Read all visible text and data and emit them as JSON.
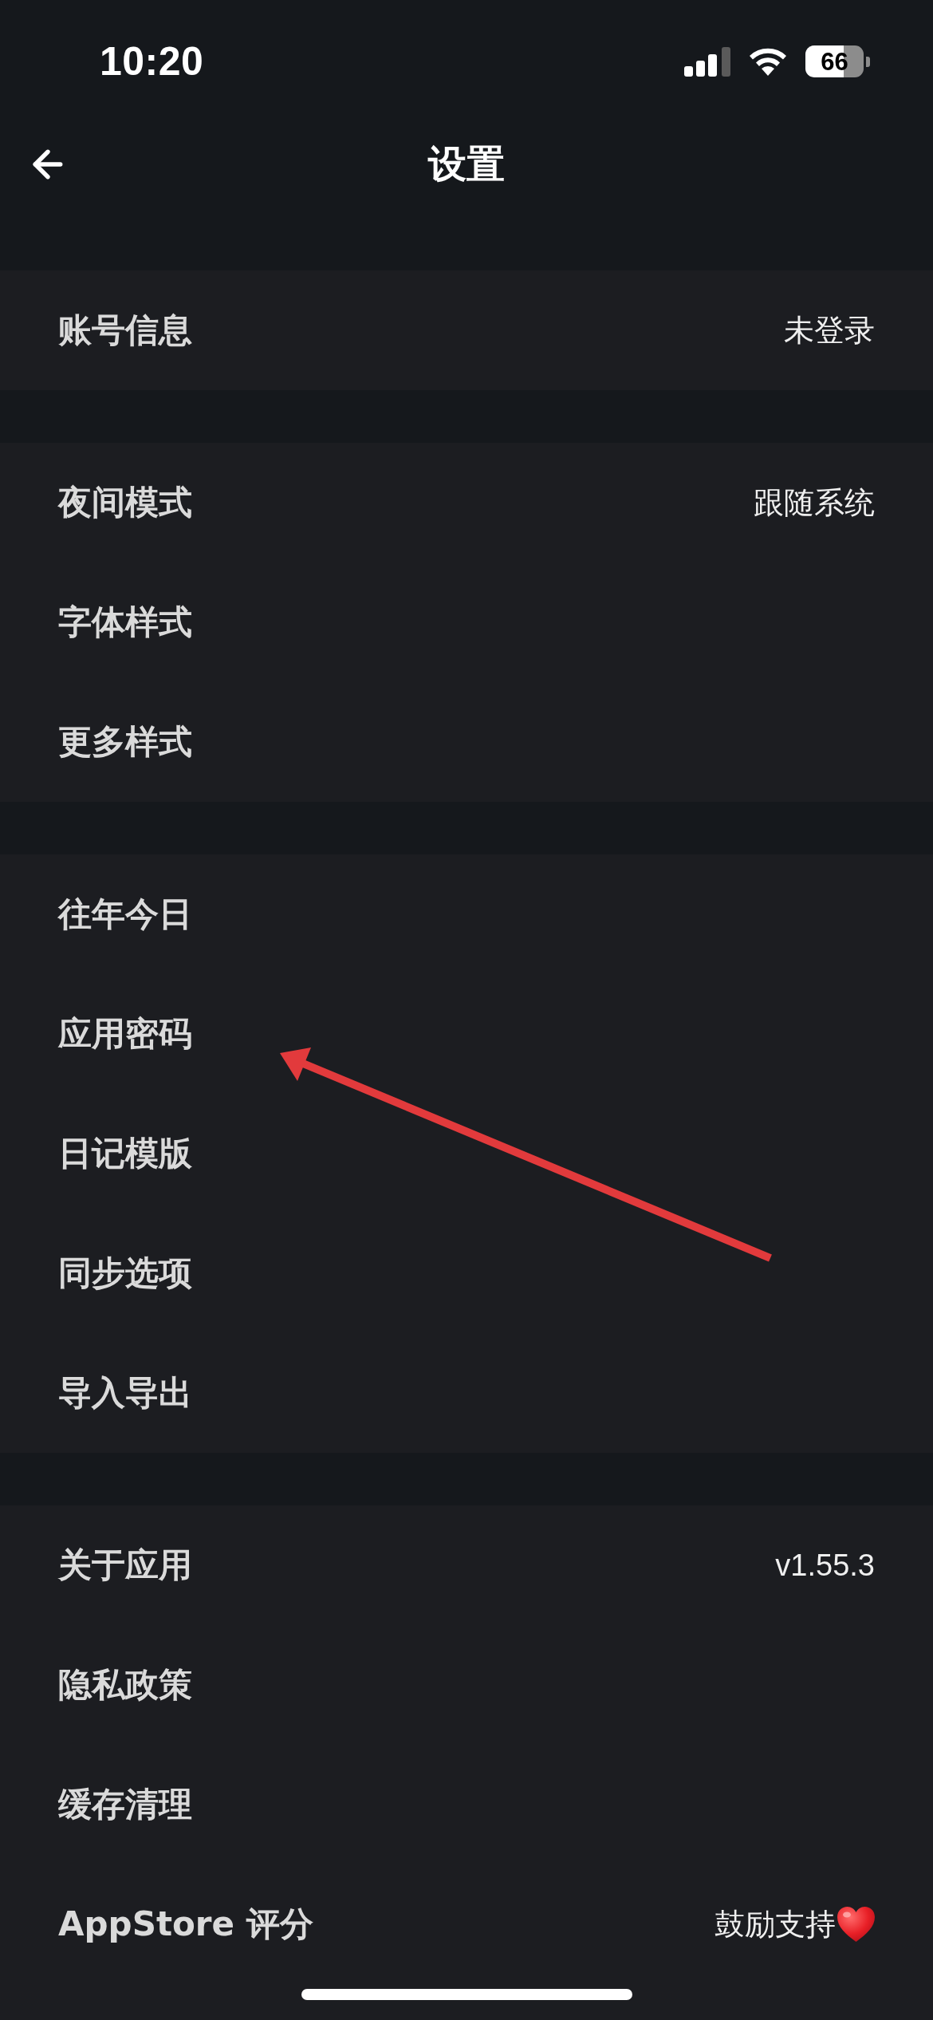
{
  "status_bar": {
    "time": "10:20",
    "battery": "66"
  },
  "nav": {
    "title": "设置"
  },
  "sections": [
    {
      "rows": [
        {
          "kind": "detail",
          "label": "账号信息",
          "value": "未登录"
        }
      ]
    },
    {
      "rows": [
        {
          "kind": "detail",
          "label": "夜间模式",
          "value": "跟随系统"
        },
        {
          "kind": "link",
          "label": "字体样式"
        },
        {
          "kind": "link",
          "label": "更多样式"
        }
      ]
    },
    {
      "rows": [
        {
          "kind": "link",
          "label": "往年今日"
        },
        {
          "kind": "link",
          "label": "应用密码"
        },
        {
          "kind": "link",
          "label": "日记模版"
        },
        {
          "kind": "link",
          "label": "同步选项"
        },
        {
          "kind": "link",
          "label": "导入导出"
        }
      ]
    },
    {
      "rows": [
        {
          "kind": "detail",
          "label": "关于应用",
          "value": "v1.55.3"
        },
        {
          "kind": "link",
          "label": "隐私政策"
        },
        {
          "kind": "link",
          "label": "缓存清理"
        },
        {
          "kind": "rating",
          "label": "AppStore 评分",
          "value": "鼓励支持"
        }
      ]
    }
  ],
  "annotation": {
    "kind": "arrow"
  }
}
